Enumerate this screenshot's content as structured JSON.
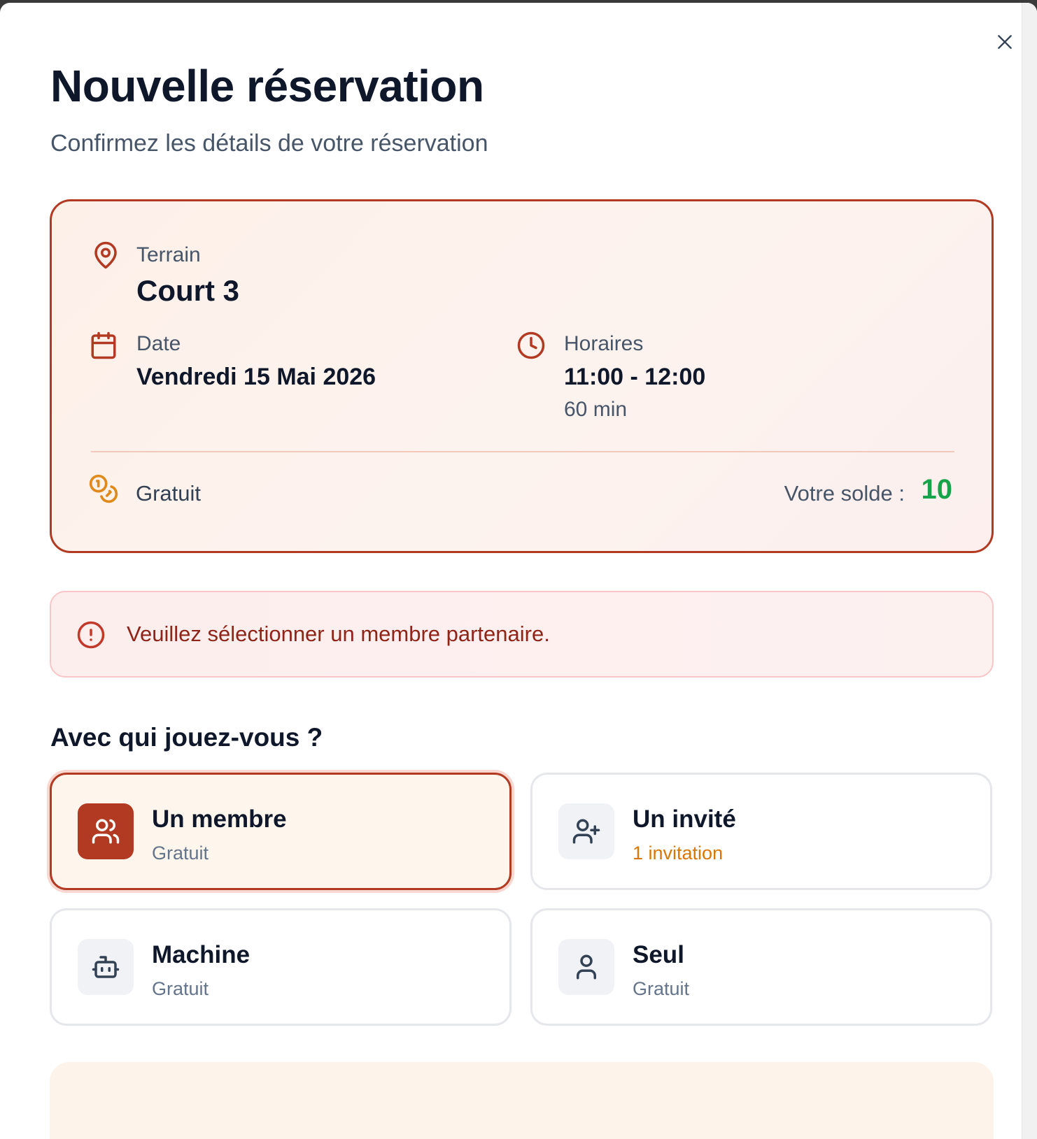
{
  "modal": {
    "title": "Nouvelle réservation",
    "subtitle": "Confirmez les détails de votre réservation"
  },
  "summary": {
    "court_label": "Terrain",
    "court_value": "Court 3",
    "date_label": "Date",
    "date_value": "Vendredi 15 Mai 2026",
    "time_label": "Horaires",
    "time_value": "11:00 - 12:00",
    "duration": "60 min",
    "price": "Gratuit",
    "balance_label": "Votre solde :",
    "balance_value": "10"
  },
  "alert": {
    "message": "Veuillez sélectionner un membre partenaire."
  },
  "partner": {
    "section_title": "Avec qui jouez-vous ?",
    "options": [
      {
        "title": "Un membre",
        "subtitle": "Gratuit",
        "icon": "users-icon",
        "selected": true
      },
      {
        "title": "Un invité",
        "subtitle": "1 invitation",
        "icon": "user-plus-icon",
        "selected": false
      },
      {
        "title": "Machine",
        "subtitle": "Gratuit",
        "icon": "bot-icon",
        "selected": false
      },
      {
        "title": "Seul",
        "subtitle": "Gratuit",
        "icon": "user-icon",
        "selected": false
      }
    ]
  },
  "colors": {
    "accent": "#b23a22",
    "balance": "#16a34a",
    "invitation": "#d97706",
    "alert_text": "#8f2418"
  }
}
